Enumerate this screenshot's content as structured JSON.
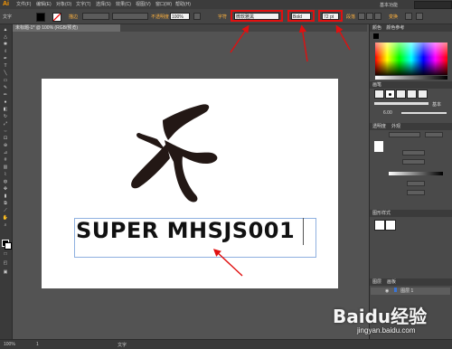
{
  "menubar": {
    "app_logo": "Ai",
    "items": [
      "文件(F)",
      "编辑(E)",
      "对象(O)",
      "文字(T)",
      "选择(S)",
      "效果(C)",
      "视图(V)",
      "窗口(W)",
      "帮助(H)"
    ],
    "workspace": "基本功能"
  },
  "control_bar": {
    "tool_label": "文字",
    "stroke_label": "描边",
    "opacity_label": "不透明度",
    "opacity_value": "100%",
    "char_label": "字符",
    "font_family": "微软雅黑",
    "font_style": "Bold",
    "font_size": "72 pt",
    "paragraph_label": "段落",
    "transform_label": "变换"
  },
  "document": {
    "tab_title": "未标题-1* @ 100% (RGB/预览)",
    "artboard_text": "SUPER MHSJS001"
  },
  "panels": {
    "color_title": "颜色",
    "color_guide_title": "颜色参考",
    "brushes_title": "画笔",
    "stroke_value": "6.00",
    "basic_label": "基本",
    "transparency_title": "透明度",
    "appearance_title": "外观",
    "graphic_styles_title": "图形样式",
    "layers_title": "图层",
    "layer_name": "图层 1",
    "artboards_title": "画板"
  },
  "status_bar": {
    "zoom": "100%",
    "page": "1",
    "tool_name": "文字"
  },
  "watermark": {
    "brand": "Baidu经验",
    "url": "jingyan.baidu.com"
  },
  "colors": {
    "highlight_red": "#e01010",
    "logo_fill": "#231815",
    "ai_orange": "#ff9a00"
  }
}
